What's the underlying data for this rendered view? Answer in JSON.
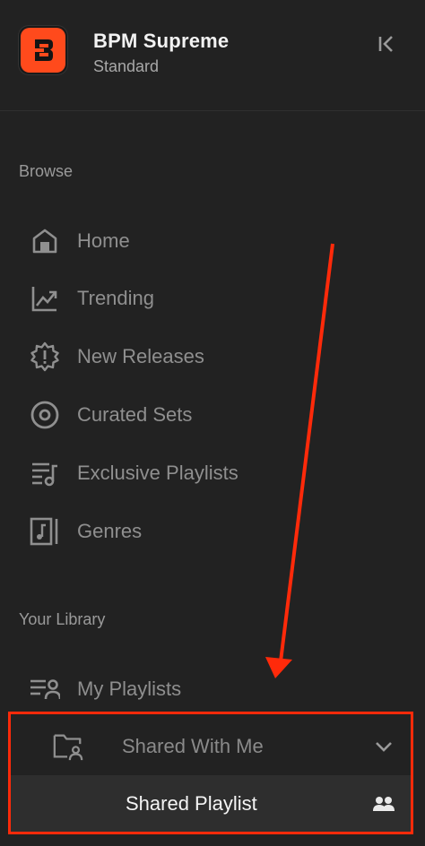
{
  "app": {
    "name": "BPM Supreme",
    "plan": "Standard"
  },
  "sections": {
    "browse": "Browse",
    "library": "Your Library"
  },
  "browse_items": [
    {
      "label": "Home",
      "icon": "home-icon"
    },
    {
      "label": "Trending",
      "icon": "trending-icon"
    },
    {
      "label": "New Releases",
      "icon": "new-releases-icon"
    },
    {
      "label": "Curated Sets",
      "icon": "curated-sets-icon"
    },
    {
      "label": "Exclusive Playlists",
      "icon": "exclusive-playlists-icon"
    },
    {
      "label": "Genres",
      "icon": "genres-icon"
    }
  ],
  "library_items": [
    {
      "label": "My Playlists",
      "icon": "my-playlists-icon"
    },
    {
      "label": "Shared With Me",
      "icon": "shared-folder-icon"
    }
  ],
  "shared_sub_items": [
    {
      "label": "Shared Playlist",
      "icon": "users-icon"
    }
  ],
  "colors": {
    "background": "#222222",
    "brand": "#ff4a1c",
    "annotation": "#ff2a0a",
    "nav_text": "#8f8f8f"
  }
}
